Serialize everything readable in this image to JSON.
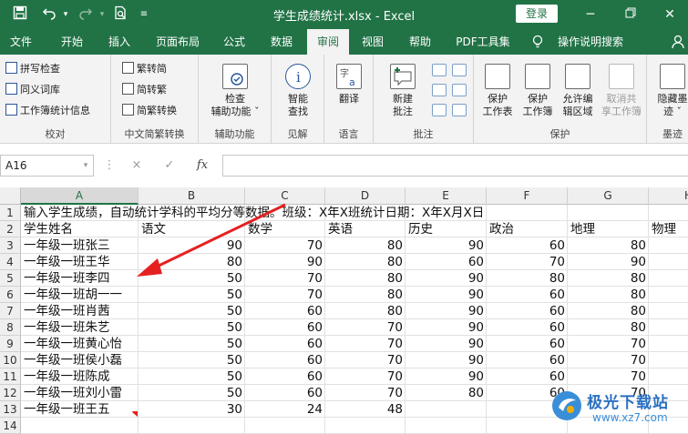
{
  "titlebar": {
    "title": "学生成绩统计.xlsx  -  Excel",
    "login": "登录",
    "save_icon": "save-icon",
    "undo_icon": "undo-icon",
    "redo_icon": "redo-icon",
    "preview_icon": "print-preview-icon",
    "customize_icon": "customize-quick-access-icon",
    "minimize_icon": "minimize-icon",
    "restore_icon": "restore-icon",
    "close_icon": "close-icon"
  },
  "menu_tabs": [
    "文件",
    "开始",
    "插入",
    "页面布局",
    "公式",
    "数据",
    "审阅",
    "视图",
    "帮助",
    "PDF工具集",
    "操作说明搜索"
  ],
  "active_tab": "审阅",
  "ribbon": {
    "proofing": {
      "label": "校对",
      "items": [
        "拼写检查",
        "同义词库",
        "工作簿统计信息"
      ]
    },
    "chinese_conversion": {
      "label": "中文简繁转换",
      "items": [
        "繁转简",
        "简转繁",
        "简繁转换"
      ]
    },
    "accessibility": {
      "label": "辅助功能",
      "button": [
        "检查",
        "辅助功能 ˇ"
      ]
    },
    "insights": {
      "label": "见解",
      "button": [
        "智能",
        "查找"
      ]
    },
    "language": {
      "label": "语言",
      "button": [
        "翻译"
      ]
    },
    "comments": {
      "label": "批注",
      "button": [
        "新建",
        "批注"
      ]
    },
    "protect": {
      "label": "保护",
      "buttons": [
        {
          "lines": [
            "保护",
            "工作表"
          ]
        },
        {
          "lines": [
            "保护",
            "工作簿"
          ]
        },
        {
          "lines": [
            "允许编",
            "辑区域"
          ]
        },
        {
          "lines": [
            "取消共",
            "享工作簿"
          ]
        }
      ]
    },
    "ink": {
      "label": "墨迹",
      "button": [
        "隐藏墨",
        "迹 ˇ"
      ]
    }
  },
  "formula_bar": {
    "name_box": "A16",
    "cancel": "×",
    "enter": "✓",
    "fx": "fx",
    "value": ""
  },
  "grid": {
    "columns": [
      "A",
      "B",
      "C",
      "D",
      "E",
      "F",
      "G",
      "H"
    ],
    "selected_column": "A",
    "rows": [
      "1",
      "2",
      "3",
      "4",
      "5",
      "6",
      "7",
      "8",
      "9",
      "10",
      "11",
      "12",
      "13",
      "14"
    ],
    "selected_row": "16",
    "row1_text": "输入学生成绩，自动统计学科的平均分等数据。班级：X年X班统计日期：X年X月X日",
    "headers": [
      "学生姓名",
      "语文",
      "数学",
      "英语",
      "历史",
      "政治",
      "地理",
      "物理"
    ],
    "data": [
      [
        "一年级一班张三",
        "90",
        "70",
        "80",
        "90",
        "60",
        "80"
      ],
      [
        "一年级一班王华",
        "80",
        "90",
        "80",
        "60",
        "70",
        "90"
      ],
      [
        "一年级一班李四",
        "50",
        "70",
        "80",
        "90",
        "80",
        "80"
      ],
      [
        "一年级一班胡一一",
        "50",
        "70",
        "80",
        "90",
        "60",
        "80"
      ],
      [
        "一年级一班肖茜",
        "50",
        "60",
        "80",
        "90",
        "60",
        "80"
      ],
      [
        "一年级一班朱艺",
        "50",
        "60",
        "70",
        "90",
        "60",
        "80"
      ],
      [
        "一年级一班黄心怡",
        "50",
        "60",
        "70",
        "90",
        "60",
        "70"
      ],
      [
        "一年级一班侯小磊",
        "50",
        "60",
        "70",
        "90",
        "60",
        "70"
      ],
      [
        "一年级一班陈成",
        "50",
        "60",
        "70",
        "90",
        "60",
        "70"
      ],
      [
        "一年级一班刘小雷",
        "50",
        "60",
        "70",
        "80",
        "60",
        "70"
      ],
      [
        "一年级一班王五",
        "30",
        "24",
        "48",
        "",
        "",
        ""
      ]
    ]
  },
  "watermark": {
    "name": "极光下载站",
    "url": "www.xz7.com"
  },
  "colors": {
    "excel_green": "#217346",
    "arrow_red": "#e52020"
  }
}
